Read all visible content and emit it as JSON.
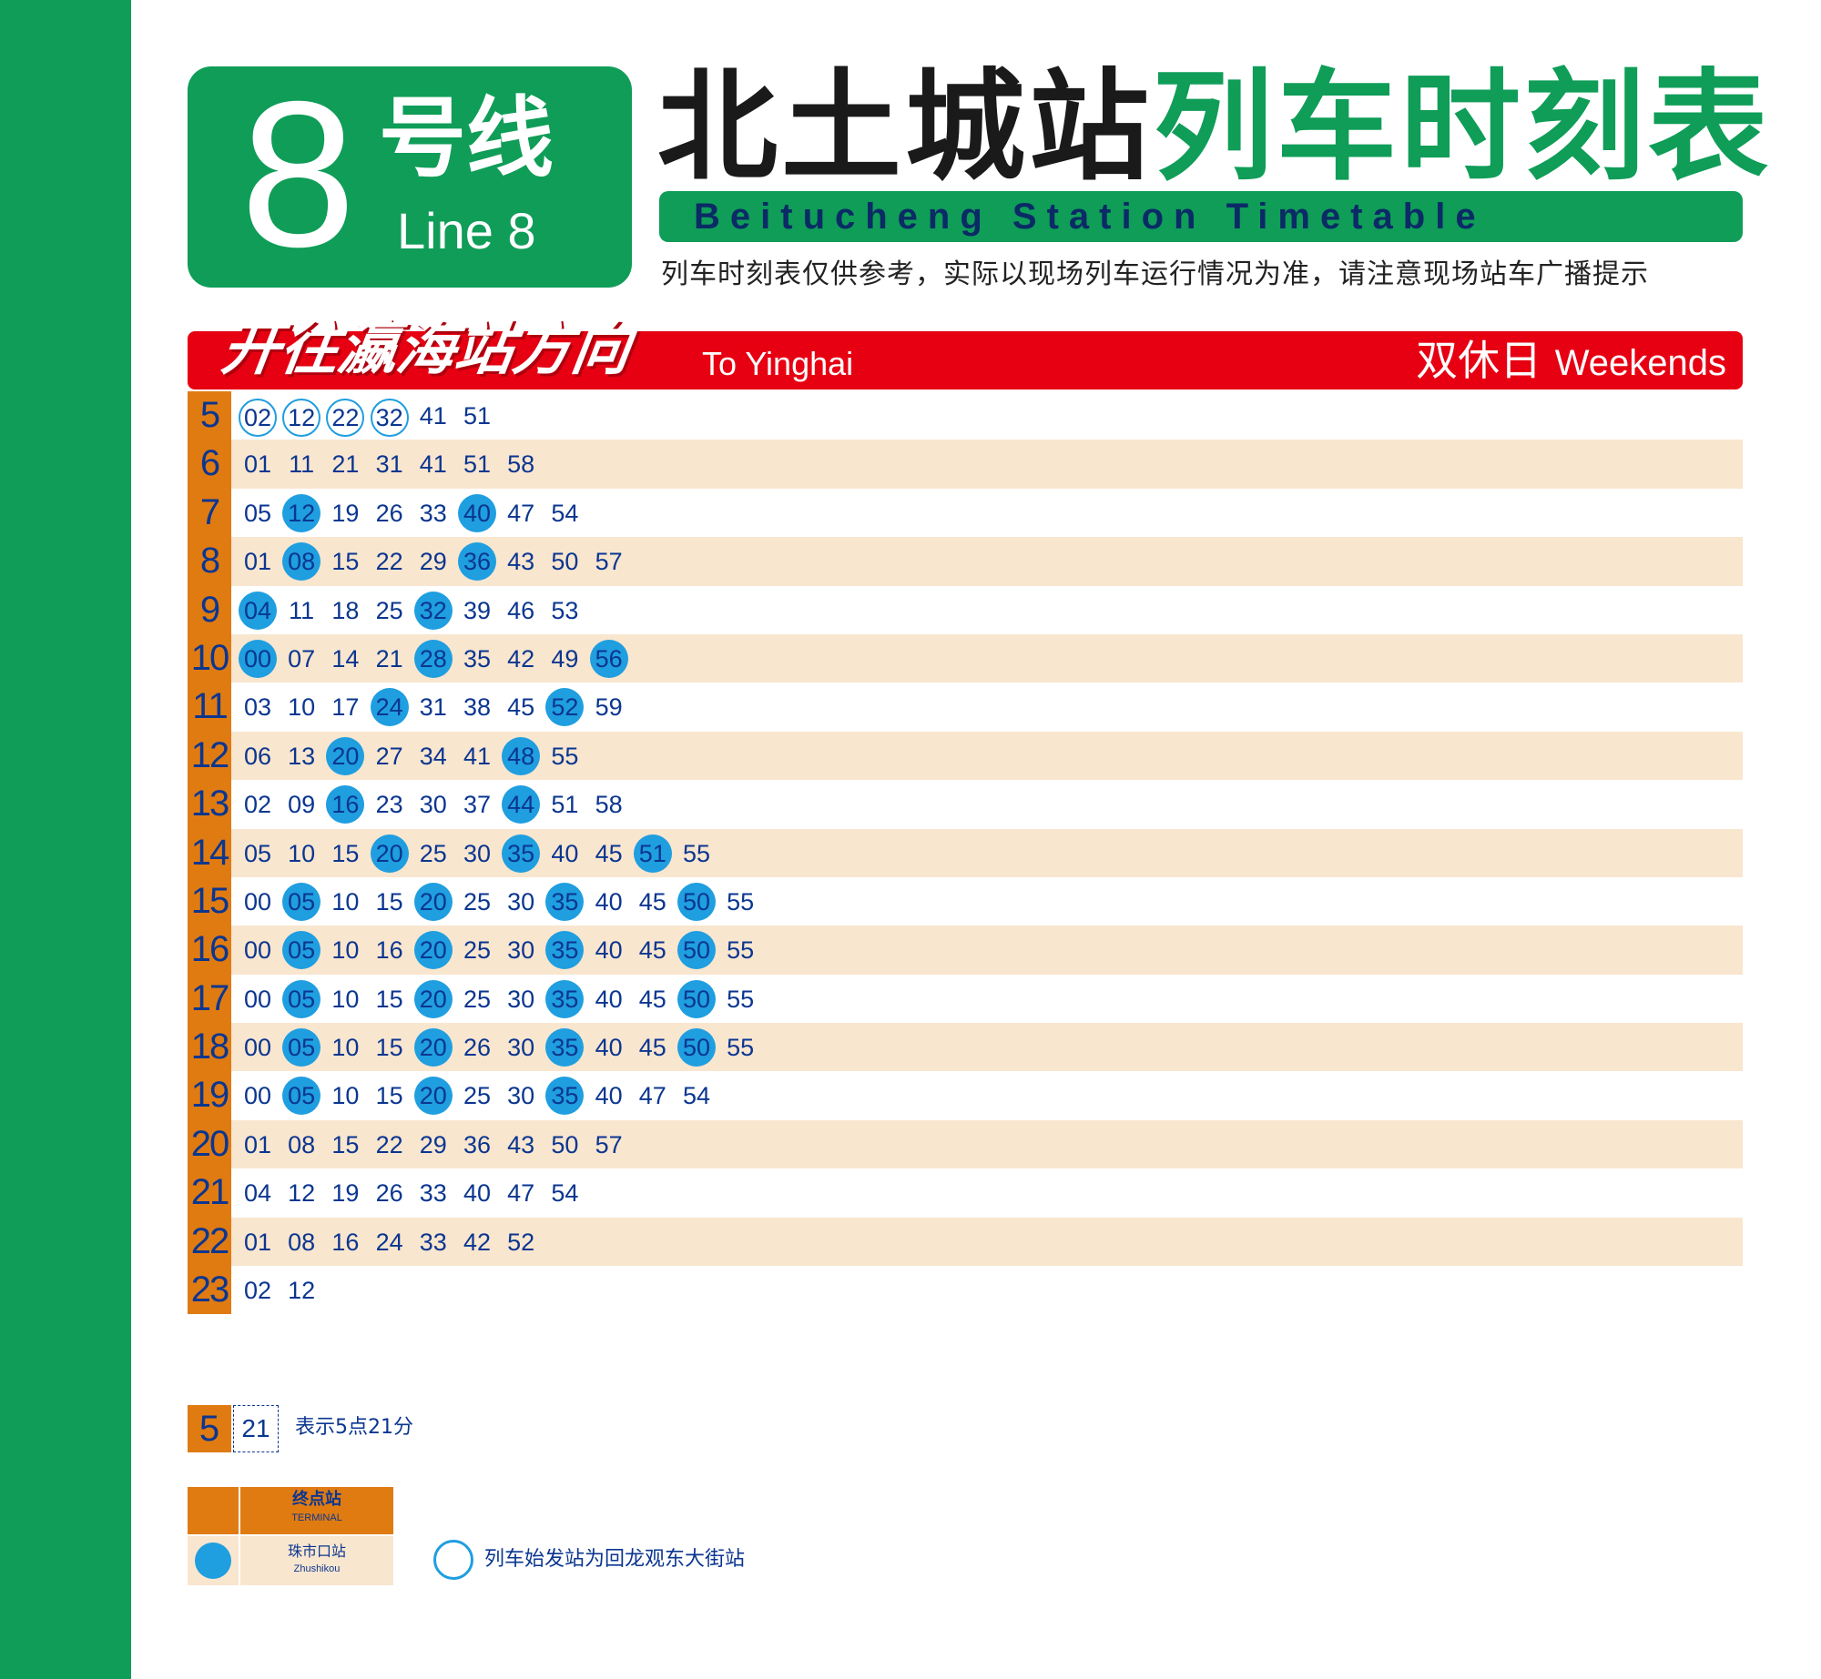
{
  "header": {
    "line_number": "8",
    "line_cn": "号线",
    "line_en": "Line 8",
    "station_cn": "北土城站",
    "timetable_cn": "列车时刻表",
    "subtitle_en": "Beitucheng Station Timetable",
    "notice": "列车时刻表仅供参考，实际以现场列车运行情况为准，请注意现场站车广播提示"
  },
  "direction": {
    "cn": "开往瀛海站方向",
    "en": "To Yinghai",
    "day_cn": "双休日",
    "day_en": "Weekends"
  },
  "colors": {
    "line_green": "#0f9d58",
    "direction_red": "#e60012",
    "hour_orange": "#e07b12",
    "alt_row": "#f9e6cf",
    "terminal_blue": "#1f9ee0",
    "text_blue": "#0b3690"
  },
  "timetable": [
    {
      "hour": "5",
      "minutes": [
        {
          "m": "02",
          "mark": "origin"
        },
        {
          "m": "12",
          "mark": "origin"
        },
        {
          "m": "22",
          "mark": "origin"
        },
        {
          "m": "32",
          "mark": "origin"
        },
        {
          "m": "41"
        },
        {
          "m": "51"
        }
      ]
    },
    {
      "hour": "6",
      "minutes": [
        {
          "m": "01"
        },
        {
          "m": "11"
        },
        {
          "m": "21"
        },
        {
          "m": "31"
        },
        {
          "m": "41"
        },
        {
          "m": "51"
        },
        {
          "m": "58"
        }
      ]
    },
    {
      "hour": "7",
      "minutes": [
        {
          "m": "05"
        },
        {
          "m": "12",
          "mark": "terminal"
        },
        {
          "m": "19"
        },
        {
          "m": "26"
        },
        {
          "m": "33"
        },
        {
          "m": "40",
          "mark": "terminal"
        },
        {
          "m": "47"
        },
        {
          "m": "54"
        }
      ]
    },
    {
      "hour": "8",
      "minutes": [
        {
          "m": "01"
        },
        {
          "m": "08",
          "mark": "terminal"
        },
        {
          "m": "15"
        },
        {
          "m": "22"
        },
        {
          "m": "29"
        },
        {
          "m": "36",
          "mark": "terminal"
        },
        {
          "m": "43"
        },
        {
          "m": "50"
        },
        {
          "m": "57"
        }
      ]
    },
    {
      "hour": "9",
      "minutes": [
        {
          "m": "04",
          "mark": "terminal"
        },
        {
          "m": "11"
        },
        {
          "m": "18"
        },
        {
          "m": "25"
        },
        {
          "m": "32",
          "mark": "terminal"
        },
        {
          "m": "39"
        },
        {
          "m": "46"
        },
        {
          "m": "53"
        }
      ]
    },
    {
      "hour": "10",
      "minutes": [
        {
          "m": "00",
          "mark": "terminal"
        },
        {
          "m": "07"
        },
        {
          "m": "14"
        },
        {
          "m": "21"
        },
        {
          "m": "28",
          "mark": "terminal"
        },
        {
          "m": "35"
        },
        {
          "m": "42"
        },
        {
          "m": "49"
        },
        {
          "m": "56",
          "mark": "terminal"
        }
      ]
    },
    {
      "hour": "11",
      "minutes": [
        {
          "m": "03"
        },
        {
          "m": "10"
        },
        {
          "m": "17"
        },
        {
          "m": "24",
          "mark": "terminal"
        },
        {
          "m": "31"
        },
        {
          "m": "38"
        },
        {
          "m": "45"
        },
        {
          "m": "52",
          "mark": "terminal"
        },
        {
          "m": "59"
        }
      ]
    },
    {
      "hour": "12",
      "minutes": [
        {
          "m": "06"
        },
        {
          "m": "13"
        },
        {
          "m": "20",
          "mark": "terminal"
        },
        {
          "m": "27"
        },
        {
          "m": "34"
        },
        {
          "m": "41"
        },
        {
          "m": "48",
          "mark": "terminal"
        },
        {
          "m": "55"
        }
      ]
    },
    {
      "hour": "13",
      "minutes": [
        {
          "m": "02"
        },
        {
          "m": "09"
        },
        {
          "m": "16",
          "mark": "terminal"
        },
        {
          "m": "23"
        },
        {
          "m": "30"
        },
        {
          "m": "37"
        },
        {
          "m": "44",
          "mark": "terminal"
        },
        {
          "m": "51"
        },
        {
          "m": "58"
        }
      ]
    },
    {
      "hour": "14",
      "minutes": [
        {
          "m": "05"
        },
        {
          "m": "10"
        },
        {
          "m": "15"
        },
        {
          "m": "20",
          "mark": "terminal"
        },
        {
          "m": "25"
        },
        {
          "m": "30"
        },
        {
          "m": "35",
          "mark": "terminal"
        },
        {
          "m": "40"
        },
        {
          "m": "45"
        },
        {
          "m": "51",
          "mark": "terminal"
        },
        {
          "m": "55"
        }
      ]
    },
    {
      "hour": "15",
      "minutes": [
        {
          "m": "00"
        },
        {
          "m": "05",
          "mark": "terminal"
        },
        {
          "m": "10"
        },
        {
          "m": "15"
        },
        {
          "m": "20",
          "mark": "terminal"
        },
        {
          "m": "25"
        },
        {
          "m": "30"
        },
        {
          "m": "35",
          "mark": "terminal"
        },
        {
          "m": "40"
        },
        {
          "m": "45"
        },
        {
          "m": "50",
          "mark": "terminal"
        },
        {
          "m": "55"
        }
      ]
    },
    {
      "hour": "16",
      "minutes": [
        {
          "m": "00"
        },
        {
          "m": "05",
          "mark": "terminal"
        },
        {
          "m": "10"
        },
        {
          "m": "16"
        },
        {
          "m": "20",
          "mark": "terminal"
        },
        {
          "m": "25"
        },
        {
          "m": "30"
        },
        {
          "m": "35",
          "mark": "terminal"
        },
        {
          "m": "40"
        },
        {
          "m": "45"
        },
        {
          "m": "50",
          "mark": "terminal"
        },
        {
          "m": "55"
        }
      ]
    },
    {
      "hour": "17",
      "minutes": [
        {
          "m": "00"
        },
        {
          "m": "05",
          "mark": "terminal"
        },
        {
          "m": "10"
        },
        {
          "m": "15"
        },
        {
          "m": "20",
          "mark": "terminal"
        },
        {
          "m": "25"
        },
        {
          "m": "30"
        },
        {
          "m": "35",
          "mark": "terminal"
        },
        {
          "m": "40"
        },
        {
          "m": "45"
        },
        {
          "m": "50",
          "mark": "terminal"
        },
        {
          "m": "55"
        }
      ]
    },
    {
      "hour": "18",
      "minutes": [
        {
          "m": "00"
        },
        {
          "m": "05",
          "mark": "terminal"
        },
        {
          "m": "10"
        },
        {
          "m": "15"
        },
        {
          "m": "20",
          "mark": "terminal"
        },
        {
          "m": "26"
        },
        {
          "m": "30"
        },
        {
          "m": "35",
          "mark": "terminal"
        },
        {
          "m": "40"
        },
        {
          "m": "45"
        },
        {
          "m": "50",
          "mark": "terminal"
        },
        {
          "m": "55"
        }
      ]
    },
    {
      "hour": "19",
      "minutes": [
        {
          "m": "00"
        },
        {
          "m": "05",
          "mark": "terminal"
        },
        {
          "m": "10"
        },
        {
          "m": "15"
        },
        {
          "m": "20",
          "mark": "terminal"
        },
        {
          "m": "25"
        },
        {
          "m": "30"
        },
        {
          "m": "35",
          "mark": "terminal"
        },
        {
          "m": "40"
        },
        {
          "m": "47"
        },
        {
          "m": "54"
        }
      ]
    },
    {
      "hour": "20",
      "minutes": [
        {
          "m": "01"
        },
        {
          "m": "08"
        },
        {
          "m": "15"
        },
        {
          "m": "22"
        },
        {
          "m": "29"
        },
        {
          "m": "36"
        },
        {
          "m": "43"
        },
        {
          "m": "50"
        },
        {
          "m": "57"
        }
      ]
    },
    {
      "hour": "21",
      "minutes": [
        {
          "m": "04"
        },
        {
          "m": "12"
        },
        {
          "m": "19"
        },
        {
          "m": "26"
        },
        {
          "m": "33"
        },
        {
          "m": "40"
        },
        {
          "m": "47"
        },
        {
          "m": "54"
        }
      ]
    },
    {
      "hour": "22",
      "minutes": [
        {
          "m": "01"
        },
        {
          "m": "08"
        },
        {
          "m": "16"
        },
        {
          "m": "24"
        },
        {
          "m": "33"
        },
        {
          "m": "42"
        },
        {
          "m": "52"
        }
      ]
    },
    {
      "hour": "23",
      "minutes": [
        {
          "m": "02"
        },
        {
          "m": "12"
        }
      ]
    }
  ],
  "legend": {
    "example_hour": "5",
    "example_minute": "21",
    "example_text": "表示5点21分",
    "terminal_header_cn": "终点站",
    "terminal_header_en": "TERMINAL",
    "terminal_name_cn": "珠市口站",
    "terminal_name_en": "Zhushikou",
    "origin_text": "列车始发站为回龙观东大街站"
  }
}
